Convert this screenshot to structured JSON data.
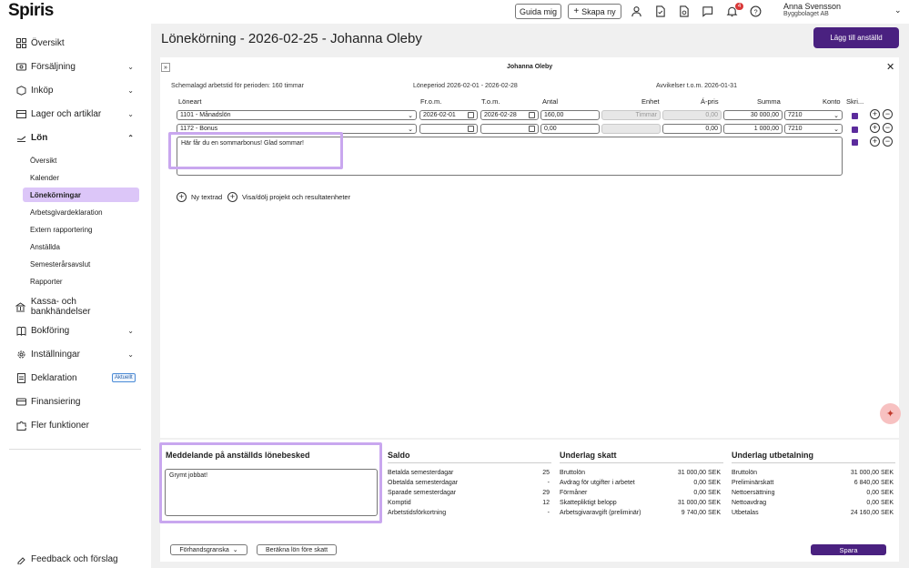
{
  "app": {
    "logo": "Spiris"
  },
  "topbar": {
    "guide_label": "Guida mig",
    "create_label": "Skapa ny",
    "notification_count": "4",
    "user_name": "Anna Svensson",
    "user_company": "Byggbolaget AB"
  },
  "sidebar": {
    "items": [
      {
        "label": "Översikt"
      },
      {
        "label": "Försäljning"
      },
      {
        "label": "Inköp"
      },
      {
        "label": "Lager och artiklar"
      },
      {
        "label": "Lön"
      },
      {
        "label": "Kassa- och bankhändelser"
      },
      {
        "label": "Bokföring"
      },
      {
        "label": "Inställningar"
      },
      {
        "label": "Deklaration",
        "tag": "Aktuellt"
      },
      {
        "label": "Finansiering"
      },
      {
        "label": "Fler funktioner"
      }
    ],
    "lon_sub": [
      {
        "label": "Översikt"
      },
      {
        "label": "Kalender"
      },
      {
        "label": "Lönekörningar"
      },
      {
        "label": "Arbetsgivardeklaration"
      },
      {
        "label": "Extern rapportering"
      },
      {
        "label": "Anställda"
      },
      {
        "label": "Semesterårsavslut"
      },
      {
        "label": "Rapporter"
      }
    ],
    "feedback_label": "Feedback och förslag"
  },
  "page": {
    "title": "Lönekörning - 2026-02-25 - Johanna Oleby",
    "add_employee_label": "Lägg till anställd"
  },
  "employee": {
    "name": "Johanna Oleby",
    "scheduled": "Schemalagd arbetstid för perioden: 160 timmar",
    "period": "Löneperiod 2026-02-01 - 2026-02-28",
    "deviations": "Avvikelser t.o.m. 2026-01-31"
  },
  "table": {
    "headers": {
      "loneart": "Löneart",
      "from": "Fr.o.m.",
      "to": "T.o.m.",
      "antal": "Antal",
      "enhet": "Enhet",
      "apris": "Á-pris",
      "summa": "Summa",
      "konto": "Konto",
      "skriv": "Skri..."
    },
    "rows": [
      {
        "loneart": "1101 - Månadslön",
        "from": "2026-02-01",
        "to": "2026-02-28",
        "antal": "160,00",
        "enhet": "Timmar",
        "apris": "0,00",
        "summa": "30 000,00",
        "konto": "7210"
      },
      {
        "loneart": "1172 - Bonus",
        "from": "",
        "to": "",
        "antal": "0,00",
        "enhet": "",
        "apris": "0,00",
        "summa": "1 000,00",
        "konto": "7210"
      }
    ],
    "text_row": "Här får du en sommarbonus! Glad sommar!"
  },
  "links": {
    "new_text_row": "Ny textrad",
    "toggle_projects": "Visa/dölj projekt och resultatenheter"
  },
  "message": {
    "title": "Meddelande på anställds lönebesked",
    "text": "Grymt jobbat!"
  },
  "saldo": {
    "title": "Saldo",
    "rows": [
      {
        "label": "Betalda semesterdagar",
        "value": "25"
      },
      {
        "label": "Obetalda semesterdagar",
        "value": "-"
      },
      {
        "label": "Sparade semesterdagar",
        "value": "29"
      },
      {
        "label": "Komptid",
        "value": "12"
      },
      {
        "label": "Arbetstidsförkortning",
        "value": "-"
      }
    ]
  },
  "skatt": {
    "title": "Underlag skatt",
    "rows": [
      {
        "label": "Bruttolön",
        "value": "31 000,00 SEK"
      },
      {
        "label": "Avdrag för utgifter i arbetet",
        "value": "0,00 SEK"
      },
      {
        "label": "Förmåner",
        "value": "0,00 SEK"
      },
      {
        "label": "Skattepliktigt belopp",
        "value": "31 000,00 SEK"
      },
      {
        "label": "Arbetsgivaravgift (preliminär)",
        "value": "9 740,00 SEK"
      }
    ]
  },
  "utbetalning": {
    "title": "Underlag utbetalning",
    "rows": [
      {
        "label": "Bruttolön",
        "value": "31 000,00 SEK"
      },
      {
        "label": "Preliminärskatt",
        "value": "6 840,00 SEK"
      },
      {
        "label": "Nettoersättning",
        "value": "0,00 SEK"
      },
      {
        "label": "Nettoavdrag",
        "value": "0,00 SEK"
      },
      {
        "label": "Utbetalas",
        "value": "24 160,00 SEK"
      }
    ]
  },
  "footer": {
    "preview_label": "Förhandsgranska",
    "calc_label": "Beräkna lön före skatt",
    "save_label": "Spara"
  }
}
